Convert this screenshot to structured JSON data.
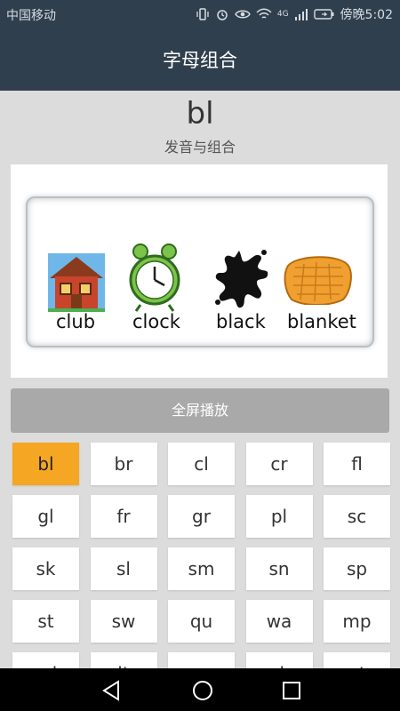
{
  "status": {
    "carrier": "中国移动",
    "time": "傍晚5:02",
    "network": "4G"
  },
  "header": {
    "title": "字母组合"
  },
  "combo": {
    "letters": "bl",
    "subtitle": "发音与组合"
  },
  "picture": {
    "words": [
      "club",
      "clock",
      "black",
      "blanket"
    ]
  },
  "play_button": "全屏播放",
  "grid": {
    "selected": "bl",
    "items": [
      "bl",
      "br",
      "cl",
      "cr",
      "fl",
      "gl",
      "fr",
      "gr",
      "pl",
      "sc",
      "sk",
      "sl",
      "sm",
      "sn",
      "sp",
      "st",
      "sw",
      "qu",
      "wa",
      "mp",
      "nd",
      "lt",
      "ng",
      "nk",
      "nt"
    ]
  },
  "colors": {
    "header_bg": "#2f3f4e",
    "selected": "#f5a623",
    "play_button_bg": "#a9a9a9"
  },
  "nav": {
    "icons": [
      "back-icon",
      "home-icon",
      "recents-icon"
    ]
  }
}
